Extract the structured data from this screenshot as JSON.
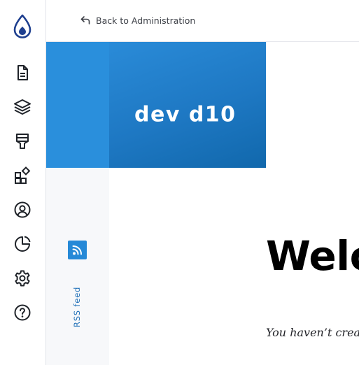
{
  "toolbar": {
    "items": [
      {
        "name": "content",
        "icon": "file-icon"
      },
      {
        "name": "structure",
        "icon": "layers-icon"
      },
      {
        "name": "appearance",
        "icon": "paintbrush-icon"
      },
      {
        "name": "extend",
        "icon": "puzzle-icon"
      },
      {
        "name": "people",
        "icon": "user-circle-icon"
      },
      {
        "name": "reports",
        "icon": "pie-chart-icon"
      },
      {
        "name": "configuration",
        "icon": "gear-icon"
      },
      {
        "name": "help",
        "icon": "help-circle-icon"
      }
    ],
    "logo_icon": "drupal-drop-icon"
  },
  "topbar": {
    "back_label": "Back to Administration",
    "back_icon": "return-arrow-icon"
  },
  "site": {
    "name": "dev d10"
  },
  "social": {
    "rss_label": "RSS feed",
    "rss_icon": "rss-icon"
  },
  "main": {
    "welcome_heading": "Welco",
    "empty_message": "You haven’t crea"
  },
  "colors": {
    "brand_blue": "#1f7bc7",
    "header_left": "#2a8fdc",
    "rss_box": "#2589d7",
    "toolbar_icon": "#1f2329"
  }
}
